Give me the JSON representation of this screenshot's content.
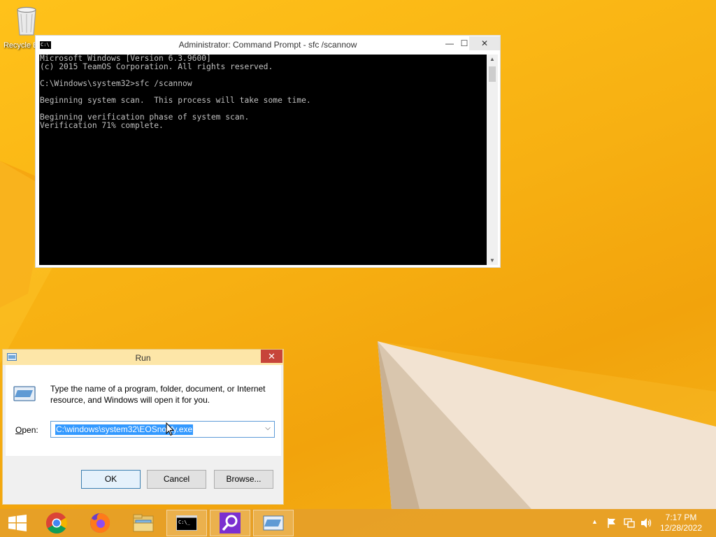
{
  "desktop": {
    "icons": [
      {
        "label": "Recycle Bin",
        "icon": "recycle-bin-icon"
      }
    ]
  },
  "cmd_window": {
    "title": "Administrator: Command Prompt - sfc  /scannow",
    "icon_text": "C:\\",
    "lines": [
      "Microsoft Windows [Version 6.3.9600]",
      "(c) 2015 TeamOS Corporation. All rights reserved.",
      "",
      "C:\\Windows\\system32>sfc /scannow",
      "",
      "Beginning system scan.  This process will take some time.",
      "",
      "Beginning verification phase of system scan.",
      "Verification 71% complete."
    ],
    "controls": {
      "minimize": "—",
      "maximize": "☐",
      "close": "✕"
    }
  },
  "run_dialog": {
    "title": "Run",
    "close": "✕",
    "description": "Type the name of a program, folder, document, or Internet resource, and Windows will open it for you.",
    "open_label_prefix": "O",
    "open_label_rest": "pen:",
    "open_value": "C:\\windows\\system32\\EOSnotify.exe",
    "buttons": {
      "ok": "OK",
      "cancel": "Cancel",
      "browse": "Browse..."
    }
  },
  "taskbar": {
    "items": [
      {
        "name": "chrome",
        "icon": "chrome-icon"
      },
      {
        "name": "firefox",
        "icon": "firefox-icon"
      },
      {
        "name": "file-explorer",
        "icon": "folder-icon"
      },
      {
        "name": "command-prompt",
        "icon": "cmd-icon",
        "active": true
      },
      {
        "name": "search",
        "icon": "magnifier-icon",
        "active": true
      },
      {
        "name": "run",
        "icon": "run-icon",
        "active": true
      }
    ],
    "cmd_icon_text": "C:\\_",
    "clock_time": "7:17 PM",
    "clock_date": "12/28/2022",
    "tray": {
      "chevron": "▲"
    }
  },
  "colors": {
    "accent": "#3399ff",
    "close_red": "#c7453a",
    "wallpaper": "#f7b012"
  }
}
